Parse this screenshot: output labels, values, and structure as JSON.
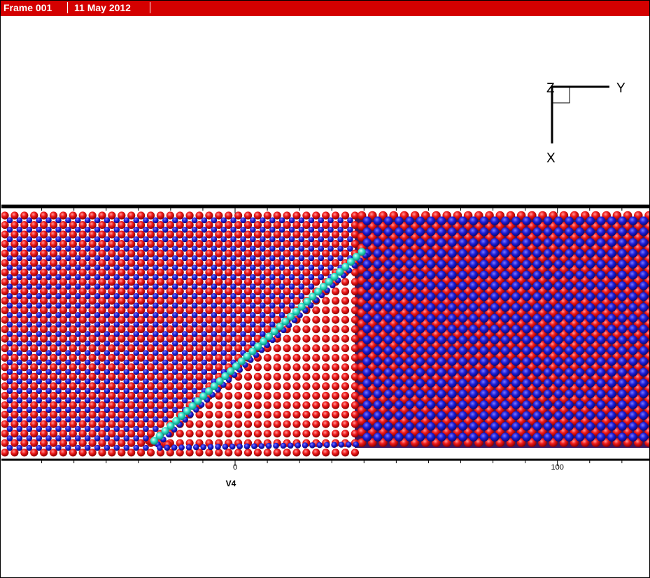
{
  "header": {
    "frame_label": "Frame 001",
    "date_label": "11 May 2012",
    "background": "#d40000"
  },
  "axis_triad": {
    "z_label": "Z",
    "y_label": "Y",
    "x_label": "X"
  },
  "chart_data": {
    "type": "scatter",
    "description_free": true,
    "xlabel": "V4",
    "ylabel": "",
    "x_ticks": [
      0,
      100
    ],
    "x_tick_labels": [
      "0",
      "100"
    ],
    "xlim": [
      -72.5,
      128.5
    ],
    "grid": false,
    "legend": "none",
    "series": [
      {
        "color": "#e81010"
      },
      {
        "color": "#1a1ad0"
      },
      {
        "color": "#30e0c8"
      }
    ],
    "slip_plane": {
      "x_start": -24,
      "x_end": 38
    },
    "interface_x": 38
  }
}
